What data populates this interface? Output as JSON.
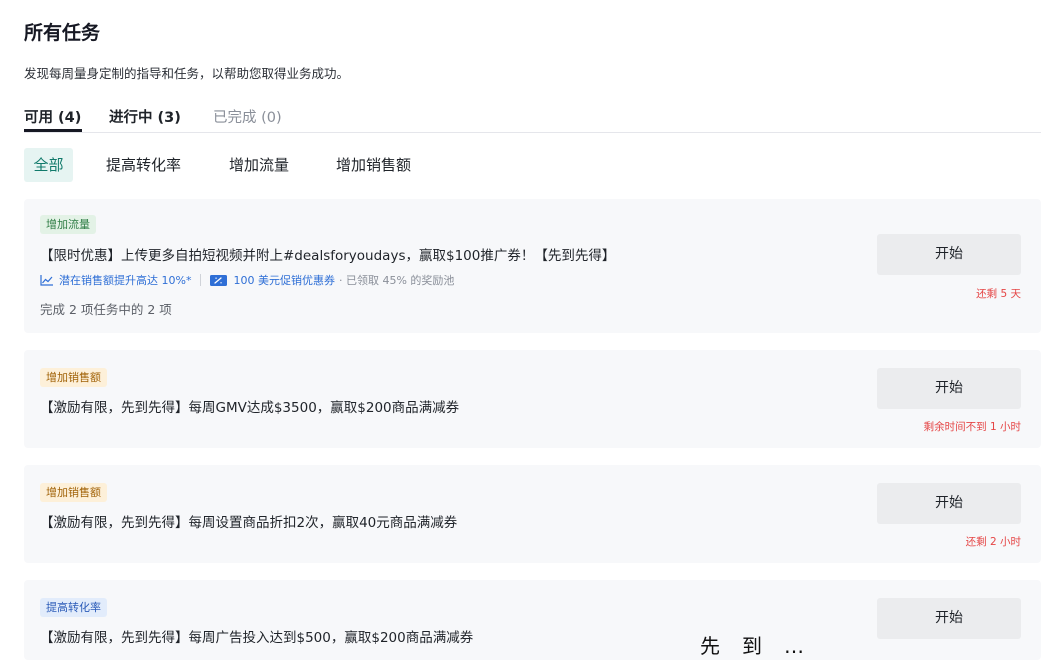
{
  "header": {
    "title": "所有任务",
    "subtitle": "发现每周量身定制的指导和任务，以帮助您取得业务成功。"
  },
  "tabs": [
    {
      "label": "可用 (4)"
    },
    {
      "label": "进行中 (3)"
    },
    {
      "label": "已完成 (0)"
    }
  ],
  "filters": [
    {
      "label": "全部"
    },
    {
      "label": "提高转化率"
    },
    {
      "label": "增加流量"
    },
    {
      "label": "增加销售额"
    }
  ],
  "colors": {
    "accent_chip_bg": "#e6f4f2",
    "accent_chip_text": "#117a6b",
    "deadline_red": "#e54545",
    "link_blue": "#2f6fd6",
    "card_bg": "#f7f8fa",
    "button_bg": "#ebecee"
  },
  "tasks": [
    {
      "tag": "增加流量",
      "title": "【限时优惠】上传更多自拍短视频并附上#dealsforyoudays，赢取$100推广券！【先到先得】",
      "potential": "潜在销售额提升高达 10%*",
      "potential_icon": "trend-chart-icon",
      "reward": "100 美元促销优惠券",
      "reward_icon": "coupon-icon",
      "pool": "· 已领取 45% 的奖励池",
      "progress": "完成 2 项任务中的 2 项",
      "button": "开始",
      "deadline": "还剩 5 天"
    },
    {
      "tag": "增加销售额",
      "title": "【激励有限，先到先得】每周GMV达成$3500，赢取$200商品满减券",
      "button": "开始",
      "deadline": "剩余时间不到 1 小时"
    },
    {
      "tag": "增加销售额",
      "title": "【激励有限，先到先得】每周设置商品折扣2次，赢取40元商品满减券",
      "button": "开始",
      "deadline": "还剩 2 小时"
    },
    {
      "tag": "提高转化率",
      "title": "【激励有限，先到先得】每周广告投入达到$500，赢取$200商品满减券",
      "button": "开始"
    }
  ],
  "overlay_text": "先到…"
}
